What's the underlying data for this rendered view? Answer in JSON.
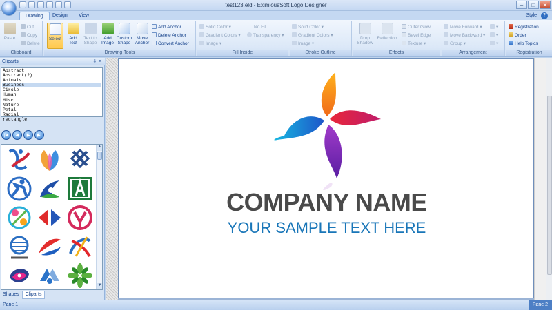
{
  "window": {
    "title": "test123.eld - EximiousSoft Logo Designer"
  },
  "tabs": [
    {
      "label": "Drawing",
      "active": true
    },
    {
      "label": "Design",
      "active": false
    },
    {
      "label": "View",
      "active": false
    }
  ],
  "style_menu": "Style",
  "ribbon": {
    "clipboard": {
      "label": "Clipboard",
      "paste": "Paste",
      "cut": "Cut",
      "copy": "Copy",
      "delete": "Delete"
    },
    "drawing_tools": {
      "label": "Drawing Tools",
      "select": "Select",
      "add_text": "Add Text",
      "text_to_shape": "Text to Shape",
      "add_image": "Add Image",
      "custom_shape": "Custom Shape",
      "move_anchor": "Move Anchor",
      "add_anchor": "Add Anchor",
      "delete_anchor": "Delete Anchor",
      "convert_anchor": "Convert Anchor"
    },
    "fill_inside": {
      "label": "Fill Inside",
      "solid_color": "Solid Color",
      "no_fill": "No Fill",
      "gradient_colors": "Gradient Colors",
      "transparency": "Transparency",
      "image": "Image"
    },
    "stroke_outline": {
      "label": "Stroke Outline",
      "solid_color": "Solid Color",
      "gradient_colors": "Gradient Colors",
      "image": "Image"
    },
    "effects": {
      "label": "Effects",
      "drop_shadow": "Drop Shadow",
      "reflection": "Reflection",
      "outer_glow": "Outer Glow",
      "bevel_edge": "Bevel Edge",
      "texture": "Texture"
    },
    "arrangement": {
      "label": "Arrangement",
      "move_forward": "Move Forward",
      "move_backward": "Move Backward",
      "group": "Group"
    },
    "registration": {
      "label": "Registration",
      "registration": "Registration",
      "order": "Order",
      "help_topics": "Help Topics"
    }
  },
  "cliparts_panel": {
    "title": "Cliparts",
    "categories": [
      "Abstract",
      "Abstract(2)",
      "Animals",
      "Business",
      "Circle",
      "Human",
      "Misc",
      "Nature",
      "Petal",
      "Radial",
      "rectangle"
    ],
    "selected_category": "Business",
    "tabs": [
      "Shapes",
      "Cliparts"
    ],
    "active_tab": "Cliparts"
  },
  "canvas": {
    "company_name": "COMPANY NAME",
    "tagline": "YOUR SAMPLE TEXT HERE"
  },
  "status": {
    "left": "Pane 1",
    "right": "Pane 2"
  },
  "colors": {
    "accent": "#15428b",
    "ribbon": "#dde9f8",
    "company_text": "#4a4a4a",
    "tagline_text": "#1976b8"
  }
}
